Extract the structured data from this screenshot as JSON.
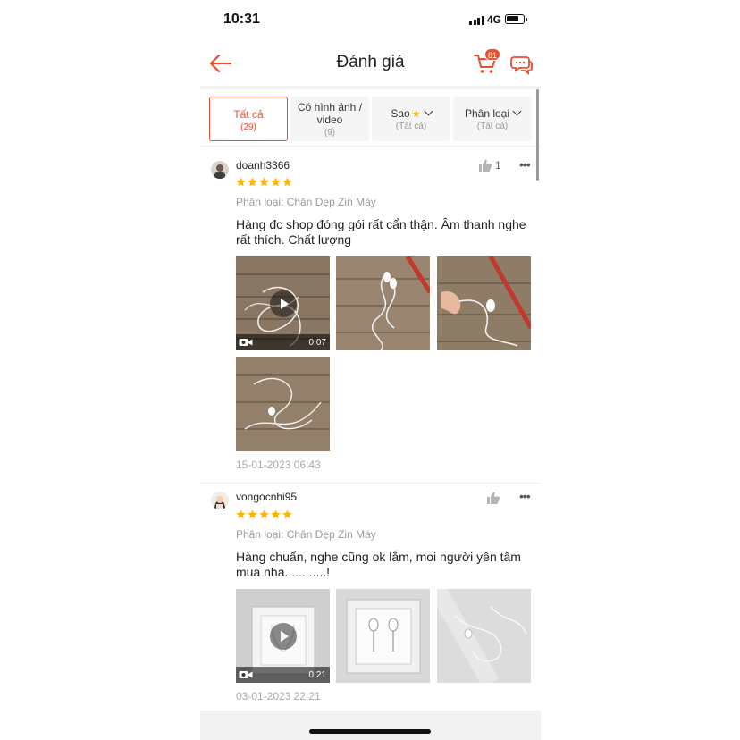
{
  "status_bar": {
    "time": "10:31",
    "network": "4G"
  },
  "header": {
    "title": "Đánh giá",
    "cart_badge": "81"
  },
  "filters": [
    {
      "label": "Tất cả",
      "sub": "(29)"
    },
    {
      "label": "Có hình ảnh / video",
      "sub": "(9)"
    },
    {
      "label": "Sao",
      "sub": "(Tất cả)"
    },
    {
      "label": "Phân loại",
      "sub": "(Tất cả)"
    }
  ],
  "reviews": [
    {
      "username": "doanh3366",
      "likes": "1",
      "rating": 5,
      "variation": "Phân loại: Chân Dẹp Zin Máy",
      "comment": "Hàng đc shop đóng gói rất cẩn thận. Âm thanh nghe rất thích. Chất lượng",
      "video_duration": "0:07",
      "date": "15-01-2023 06:43"
    },
    {
      "username": "vongocnhi95",
      "likes": "",
      "rating": 5,
      "variation": "Phân loại: Chân Dẹp Zin Máy",
      "comment": "Hàng chuẩn, nghe cũng ok lắm, moi người yên tâm mua nha............!",
      "video_duration": "0:21",
      "date": "03-01-2023 22:21"
    }
  ],
  "colors": {
    "accent": "#ee4d2d",
    "star": "#ffb400",
    "muted": "#9b9b9b"
  },
  "icons": [
    "back-arrow-icon",
    "cart-icon",
    "chat-icon",
    "thumbs-up-icon",
    "more-dots-icon",
    "star-icon",
    "play-icon",
    "video-camera-icon"
  ]
}
